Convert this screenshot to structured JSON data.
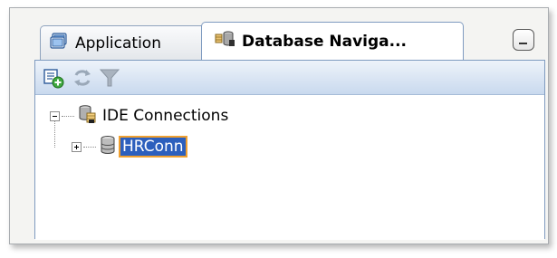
{
  "tabs": [
    {
      "label": "Application",
      "active": false,
      "icon": "application-icon"
    },
    {
      "label": "Database Naviga...",
      "active": true,
      "icon": "database-navigator-icon"
    }
  ],
  "window_controls": {
    "minimize": "minimize-icon"
  },
  "toolbar": {
    "buttons": [
      {
        "icon": "new-connection-icon",
        "enabled": true
      },
      {
        "icon": "refresh-icon",
        "enabled": false
      },
      {
        "icon": "filter-icon",
        "enabled": false
      }
    ]
  },
  "tree": {
    "root": {
      "label": "IDE Connections",
      "expanded": true,
      "icon": "ide-connections-icon"
    },
    "children": [
      {
        "label": "HRConn",
        "expanded": false,
        "selected": true,
        "icon": "database-cylinder-icon"
      }
    ]
  },
  "colors": {
    "selection_bg": "#2c5fbd",
    "selection_outline": "#f0a030",
    "toolbar_gradient_top": "#eef3fa",
    "toolbar_gradient_bottom": "#c9d9ee",
    "tab_border": "#7f9bc0"
  }
}
